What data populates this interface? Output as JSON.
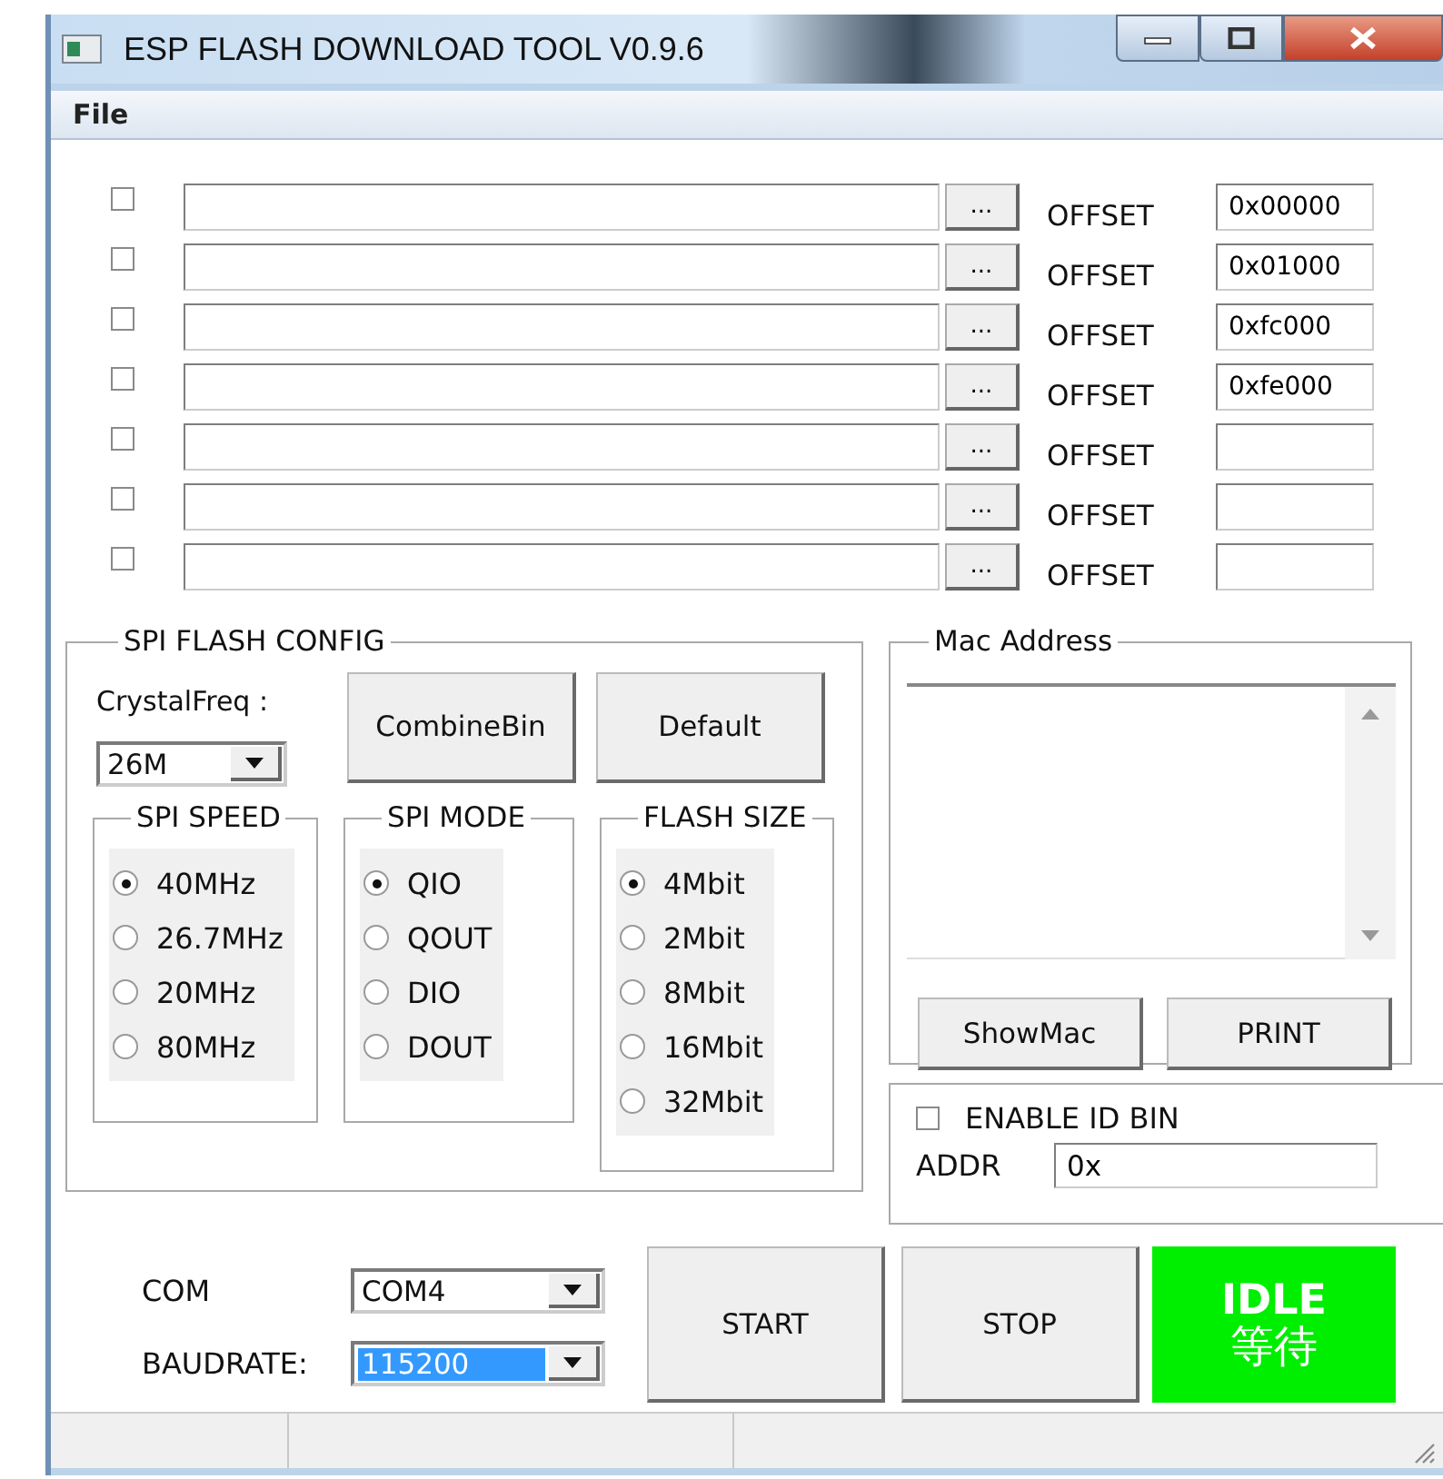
{
  "window": {
    "title": "ESP FLASH DOWNLOAD TOOL V0.9.6"
  },
  "menu": [
    "File"
  ],
  "files": [
    {
      "checked": false,
      "browse": "...",
      "offset_label": "OFFSET",
      "offset": "0x00000"
    },
    {
      "checked": false,
      "browse": "...",
      "offset_label": "OFFSET",
      "offset": "0x01000"
    },
    {
      "checked": false,
      "browse": "...",
      "offset_label": "OFFSET",
      "offset": "0xfc000"
    },
    {
      "checked": false,
      "browse": "...",
      "offset_label": "OFFSET",
      "offset": "0xfe000"
    },
    {
      "checked": false,
      "browse": "...",
      "offset_label": "OFFSET"
    },
    {
      "checked": false,
      "browse": "...",
      "offset_label": "OFFSET"
    },
    {
      "checked": false,
      "browse": "...",
      "offset_label": "OFFSET"
    }
  ],
  "spi_flash_config": {
    "title": "SPI FLASH CONFIG",
    "crystal_label": "CrystalFreq :",
    "crystal_value": "26M",
    "buttons": [
      "CombineBin",
      "Default"
    ],
    "groups": [
      {
        "title": "SPI SPEED",
        "options": [
          {
            "label": "40MHz",
            "selected": true
          },
          {
            "label": "26.7MHz",
            "selected": false
          },
          {
            "label": "20MHz",
            "selected": false
          },
          {
            "label": "80MHz",
            "selected": false
          }
        ]
      },
      {
        "title": "SPI MODE",
        "options": [
          {
            "label": "QIO",
            "selected": true
          },
          {
            "label": "QOUT",
            "selected": false
          },
          {
            "label": "DIO",
            "selected": false
          },
          {
            "label": "DOUT",
            "selected": false
          }
        ]
      },
      {
        "title": "FLASH SIZE",
        "options": [
          {
            "label": "4Mbit",
            "selected": true
          },
          {
            "label": "2Mbit",
            "selected": false
          },
          {
            "label": "8Mbit",
            "selected": false
          },
          {
            "label": "16Mbit",
            "selected": false
          },
          {
            "label": "32Mbit",
            "selected": false
          }
        ]
      }
    ]
  },
  "mac_address": {
    "title": "Mac Address",
    "buttons": [
      "ShowMac",
      "PRINT"
    ]
  },
  "id_bin": {
    "label": "ENABLE ID BIN",
    "checked": false,
    "addr_label": "ADDR",
    "addr_value": "0x"
  },
  "connection": {
    "com_label": "COM",
    "com_value": "COM4",
    "baud_label": "BAUDRATE:",
    "baud_value": "115200",
    "baud_value_selected": true
  },
  "actions": [
    "START",
    "STOP"
  ],
  "status": {
    "kind": "idle",
    "text": "IDLE",
    "subtext": "等待"
  }
}
